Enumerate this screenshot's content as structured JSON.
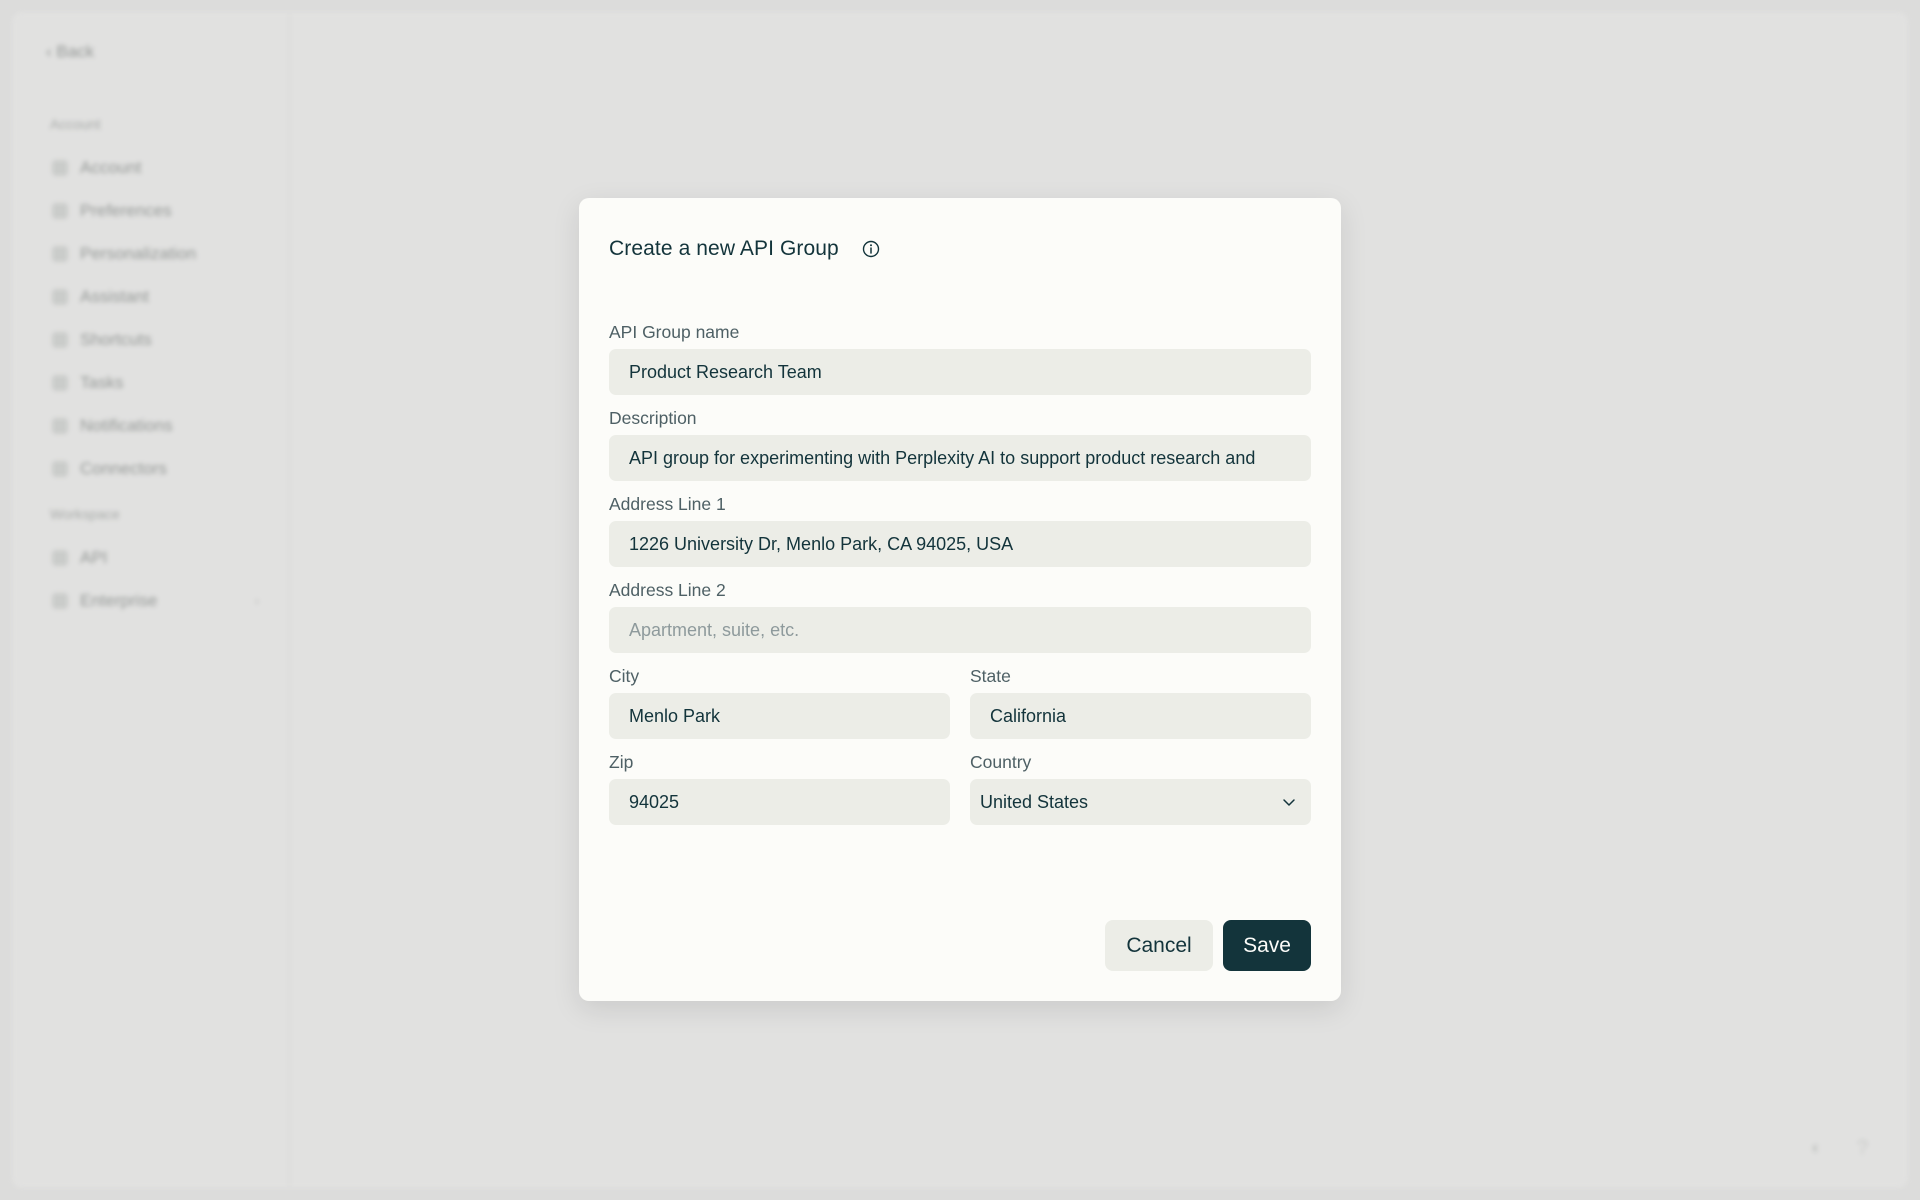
{
  "background": {
    "back_label": "Back",
    "section_account": "Account",
    "section_workspace": "Workspace",
    "items": [
      {
        "label": "Account"
      },
      {
        "label": "Preferences"
      },
      {
        "label": "Personalization"
      },
      {
        "label": "Assistant"
      },
      {
        "label": "Shortcuts"
      },
      {
        "label": "Tasks"
      },
      {
        "label": "Notifications"
      },
      {
        "label": "Connectors"
      }
    ],
    "workspace_items": [
      {
        "label": "API"
      },
      {
        "label": "Enterprise"
      }
    ]
  },
  "modal": {
    "title": "Create a new API Group",
    "fields": {
      "group_name": {
        "label": "API Group name",
        "value": "Product Research Team"
      },
      "description": {
        "label": "Description",
        "value": "API group for experimenting with Perplexity AI to support product research and"
      },
      "address1": {
        "label": "Address Line 1",
        "value": "1226 University Dr, Menlo Park, CA 94025, USA"
      },
      "address2": {
        "label": "Address Line 2",
        "placeholder": "Apartment, suite, etc."
      },
      "city": {
        "label": "City",
        "value": "Menlo Park"
      },
      "state": {
        "label": "State",
        "value": "California"
      },
      "zip": {
        "label": "Zip",
        "value": "94025"
      },
      "country": {
        "label": "Country",
        "value": "United States"
      }
    },
    "cancel_label": "Cancel",
    "save_label": "Save"
  },
  "colors": {
    "accent": "#13343b",
    "input_bg": "#ecede7",
    "modal_bg": "#fcfcf9",
    "overlay_bg": "#dcdcdb"
  }
}
